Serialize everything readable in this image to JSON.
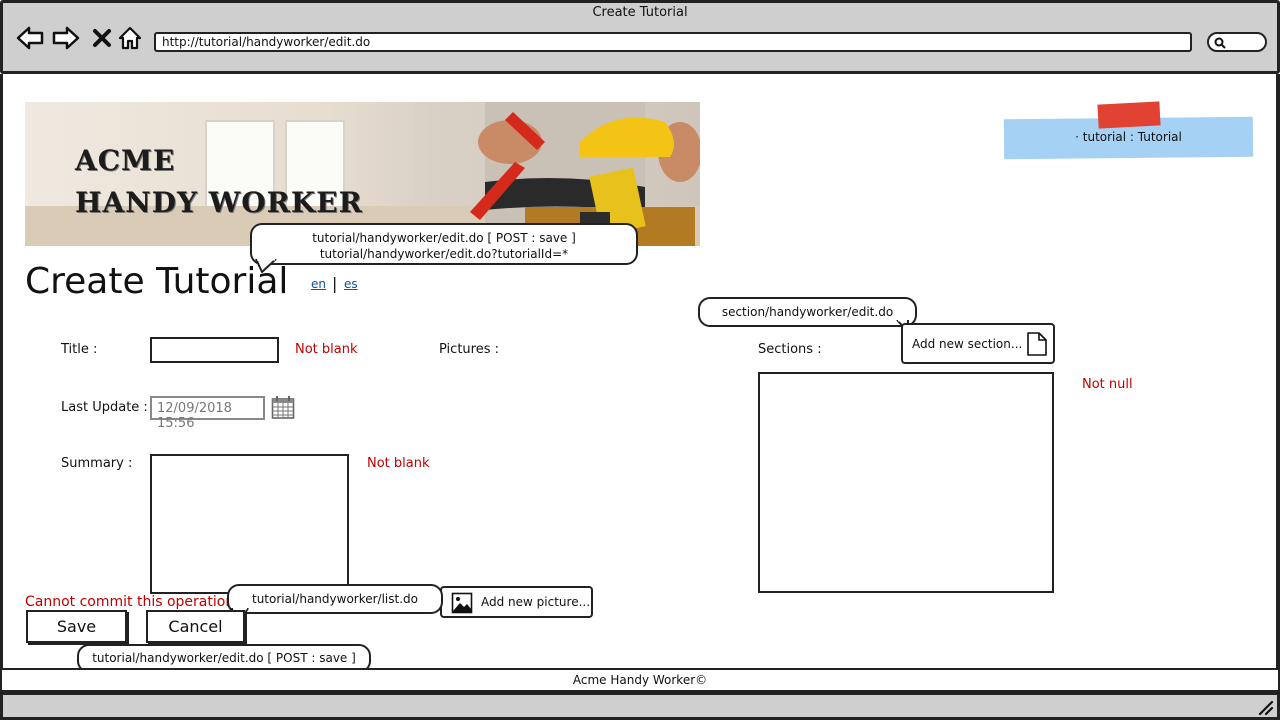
{
  "window": {
    "title": "Create Tutorial",
    "url": "http://tutorial/handyworker/edit.do"
  },
  "banner": {
    "line1": "ACME",
    "line2": "HANDY WORKER"
  },
  "user_menu": {
    "label": "· tutorial : Tutorial"
  },
  "notes": {
    "page_action_1": "tutorial/handyworker/edit.do [ POST : save ]",
    "page_action_2": "tutorial/handyworker/edit.do?tutorialId=*",
    "section_link": "section/handyworker/edit.do",
    "cancel_link": "tutorial/handyworker/list.do",
    "save_action": "tutorial/handyworker/edit.do  [ POST : save ]"
  },
  "page": {
    "title": "Create Tutorial",
    "lang_en": "en",
    "lang_sep": "|",
    "lang_es": "es"
  },
  "form": {
    "title_label": "Title :",
    "title_error": "Not blank",
    "pictures_label": "Pictures :",
    "sections_label": "Sections :",
    "add_section": "Add new section...",
    "sections_error": "Not null",
    "last_update_label": "Last Update :",
    "last_update_value": "12/09/2018 15:56",
    "summary_label": "Summary :",
    "summary_error": "Not blank",
    "add_picture": "Add new picture...",
    "commit_error": "Cannot commit this operation",
    "save_label": "Save",
    "cancel_label": "Cancel"
  },
  "footer": {
    "text": "Acme Handy Worker©"
  },
  "icons": [
    "back-arrow-icon",
    "forward-arrow-icon",
    "close-icon",
    "home-icon",
    "search-icon",
    "calendar-icon",
    "document-icon",
    "image-icon",
    "resize-grip-icon"
  ]
}
